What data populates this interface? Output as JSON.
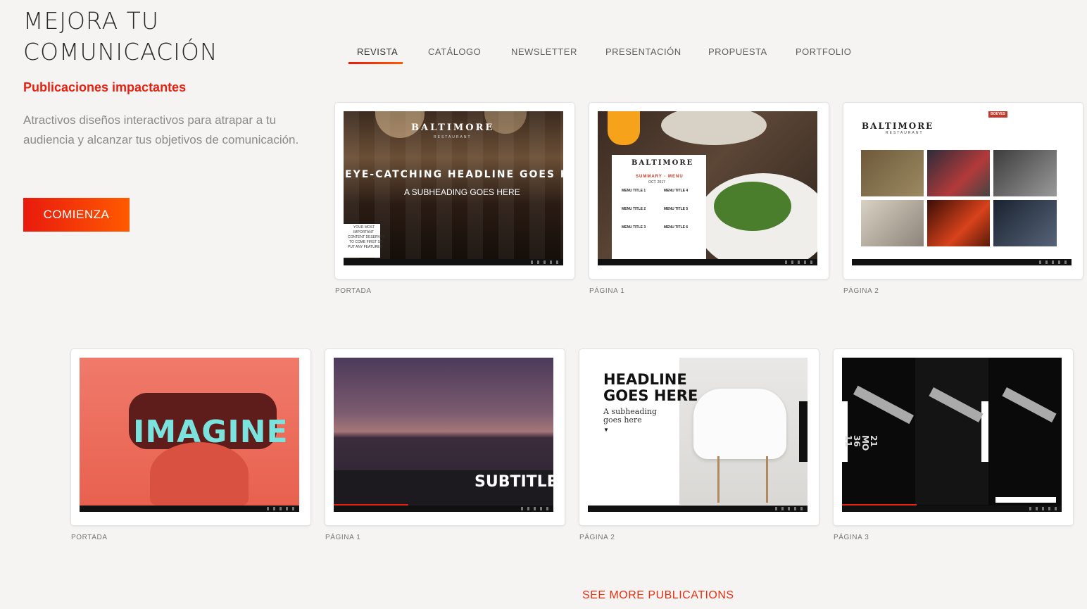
{
  "hero": {
    "title_line1": "MEJORA TU",
    "title_line2": "COMUNICACIÓN",
    "subtitle": "Publicaciones impactantes",
    "description": "Atractivos diseños interactivos para atrapar a tu audiencia y alcanzar tus objetivos de comunicación.",
    "cta_label": "COMIENZA"
  },
  "tabs": [
    {
      "label": "REVISTA",
      "active": true
    },
    {
      "label": "CATÁLOGO",
      "active": false
    },
    {
      "label": "NEWSLETTER",
      "active": false
    },
    {
      "label": "PRESENTACIÓN",
      "active": false
    },
    {
      "label": "PROPUESTA",
      "active": false
    },
    {
      "label": "PORTFOLIO",
      "active": false
    }
  ],
  "row1": {
    "cards": [
      {
        "caption": "PORTADA",
        "logo": "BALTIMORE",
        "logo_sub": "RESTAURANT",
        "headline": "EYE-CATCHING HEADLINE GOES HERE",
        "subheading": "A SUBHEADING GOES HERE",
        "side_text": [
          "YOUR MOST",
          "IMPORTANT",
          "CONTENT DESERVES",
          "TO COME FIRST SO",
          "PUT ANY FEATURED"
        ]
      },
      {
        "caption": "PÁGINA 1",
        "logo": "BALTIMORE",
        "menu_title": "SUMMARY - MENU",
        "menu_date": "OCT. 2017",
        "menu_items": [
          "MENU TITLE 1",
          "MENU TITLE 4",
          "MENU TITLE 2",
          "MENU TITLE 5",
          "MENU TITLE 3",
          "MENU TITLE 6"
        ]
      },
      {
        "caption": "PÁGINA 2",
        "logo": "BALTIMORE",
        "logo_sub": "RESTAURANT",
        "badge": "BOEYES"
      }
    ]
  },
  "row2": {
    "cards": [
      {
        "caption": "PORTADA",
        "word": "IMAGINE"
      },
      {
        "caption": "PÁGINA 1",
        "word": "SUBTITLES GO"
      },
      {
        "caption": "PÁGINA 2",
        "headline_line1": "HEADLINE",
        "headline_line2": "GOES HERE",
        "subheading_line1": "A subheading",
        "subheading_line2": "goes here"
      },
      {
        "caption": "PÁGINA 3",
        "watch_text": [
          "11",
          "36",
          "MO",
          "21"
        ]
      }
    ]
  },
  "see_more": "SEE MORE PUBLICATIONS",
  "colors": {
    "accent": "#e8200f",
    "accent_end": "#ff5a00",
    "background": "#f5f4f3"
  }
}
